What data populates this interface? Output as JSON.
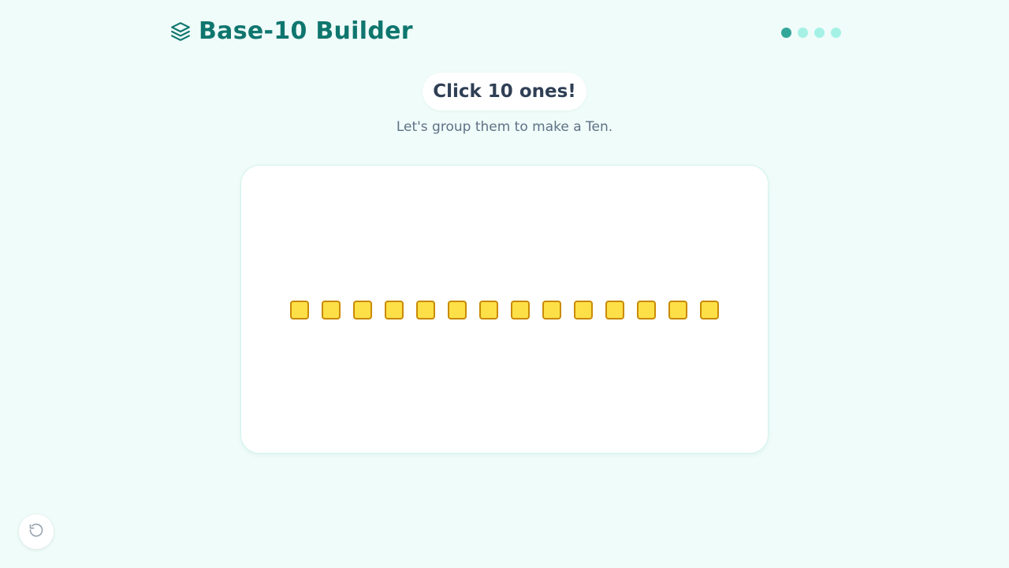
{
  "header": {
    "title": "Base-10 Builder",
    "logo_icon": "layers-icon",
    "progress": {
      "total_steps": 4,
      "current_step": 1
    }
  },
  "instruction": {
    "prompt": "Click 10 ones!",
    "subtitle": "Let's group them to make a Ten."
  },
  "board": {
    "ones_count": 14,
    "one_block_color": "#fde047",
    "one_block_border": "#ca8a04"
  },
  "controls": {
    "reset_icon": "reset-icon"
  },
  "colors": {
    "background": "#effcf9",
    "title": "#0f766e",
    "dot_active": "#33a69a",
    "dot_inactive": "#a5f1e6"
  }
}
